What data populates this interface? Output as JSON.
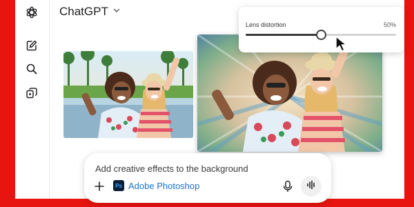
{
  "app": {
    "title": "ChatGPT"
  },
  "sidebar": {
    "items": [
      {
        "icon": "openai-logo-icon"
      },
      {
        "icon": "new-chat-icon"
      },
      {
        "icon": "search-icon"
      },
      {
        "icon": "library-icon"
      }
    ]
  },
  "lens_slider": {
    "label": "Lens distortion",
    "value_text": "50%",
    "value": 0.5
  },
  "composer": {
    "prompt": "Add creative effects to the background",
    "tool_badge": "Ps",
    "tool_name": "Adobe Photoshop"
  },
  "colors": {
    "brand_red": "#e8140f",
    "photoshop_blue": "#31a8ff",
    "link_blue": "#1a73c8"
  }
}
